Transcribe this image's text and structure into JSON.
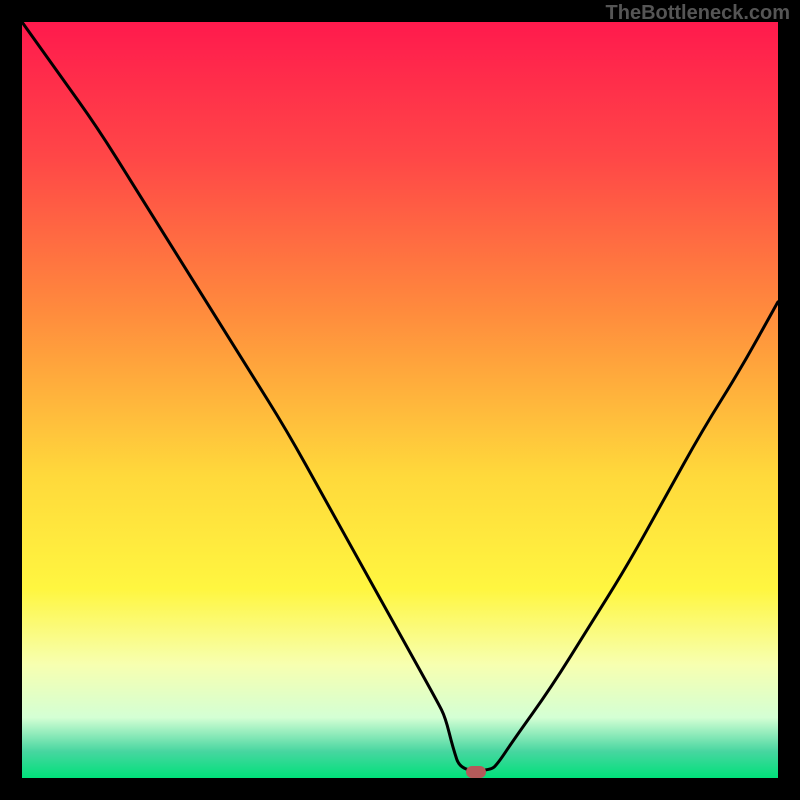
{
  "watermark": "TheBottleneck.com",
  "chart_data": {
    "type": "line",
    "title": "",
    "xlabel": "",
    "ylabel": "",
    "xlim": [
      0,
      100
    ],
    "ylim": [
      0,
      100
    ],
    "grid": false,
    "series": [
      {
        "name": "curve",
        "x": [
          0,
          5,
          10,
          15,
          20,
          25,
          30,
          35,
          40,
          45,
          50,
          55,
          56,
          57,
          58,
          62,
          63,
          65,
          70,
          75,
          80,
          85,
          90,
          95,
          100
        ],
        "values": [
          100,
          93,
          86,
          78,
          70,
          62,
          54,
          46,
          37,
          28,
          19,
          10,
          8,
          4,
          1,
          1,
          2,
          5,
          12,
          20,
          28,
          37,
          46,
          54,
          63
        ]
      }
    ],
    "annotations": [],
    "marker": {
      "x": 60,
      "y": 0.8,
      "color": "#b45a5a"
    },
    "background": "heatmap-gradient",
    "gradient_stops": [
      {
        "pos": 0.0,
        "color": "#ff1a4d"
      },
      {
        "pos": 0.18,
        "color": "#ff4747"
      },
      {
        "pos": 0.38,
        "color": "#ff8a3d"
      },
      {
        "pos": 0.6,
        "color": "#ffd93b"
      },
      {
        "pos": 0.75,
        "color": "#fff640"
      },
      {
        "pos": 0.85,
        "color": "#f7ffb0"
      },
      {
        "pos": 0.92,
        "color": "#d4ffd4"
      },
      {
        "pos": 0.965,
        "color": "#47d6a0"
      },
      {
        "pos": 1.0,
        "color": "#00e07a"
      }
    ]
  }
}
